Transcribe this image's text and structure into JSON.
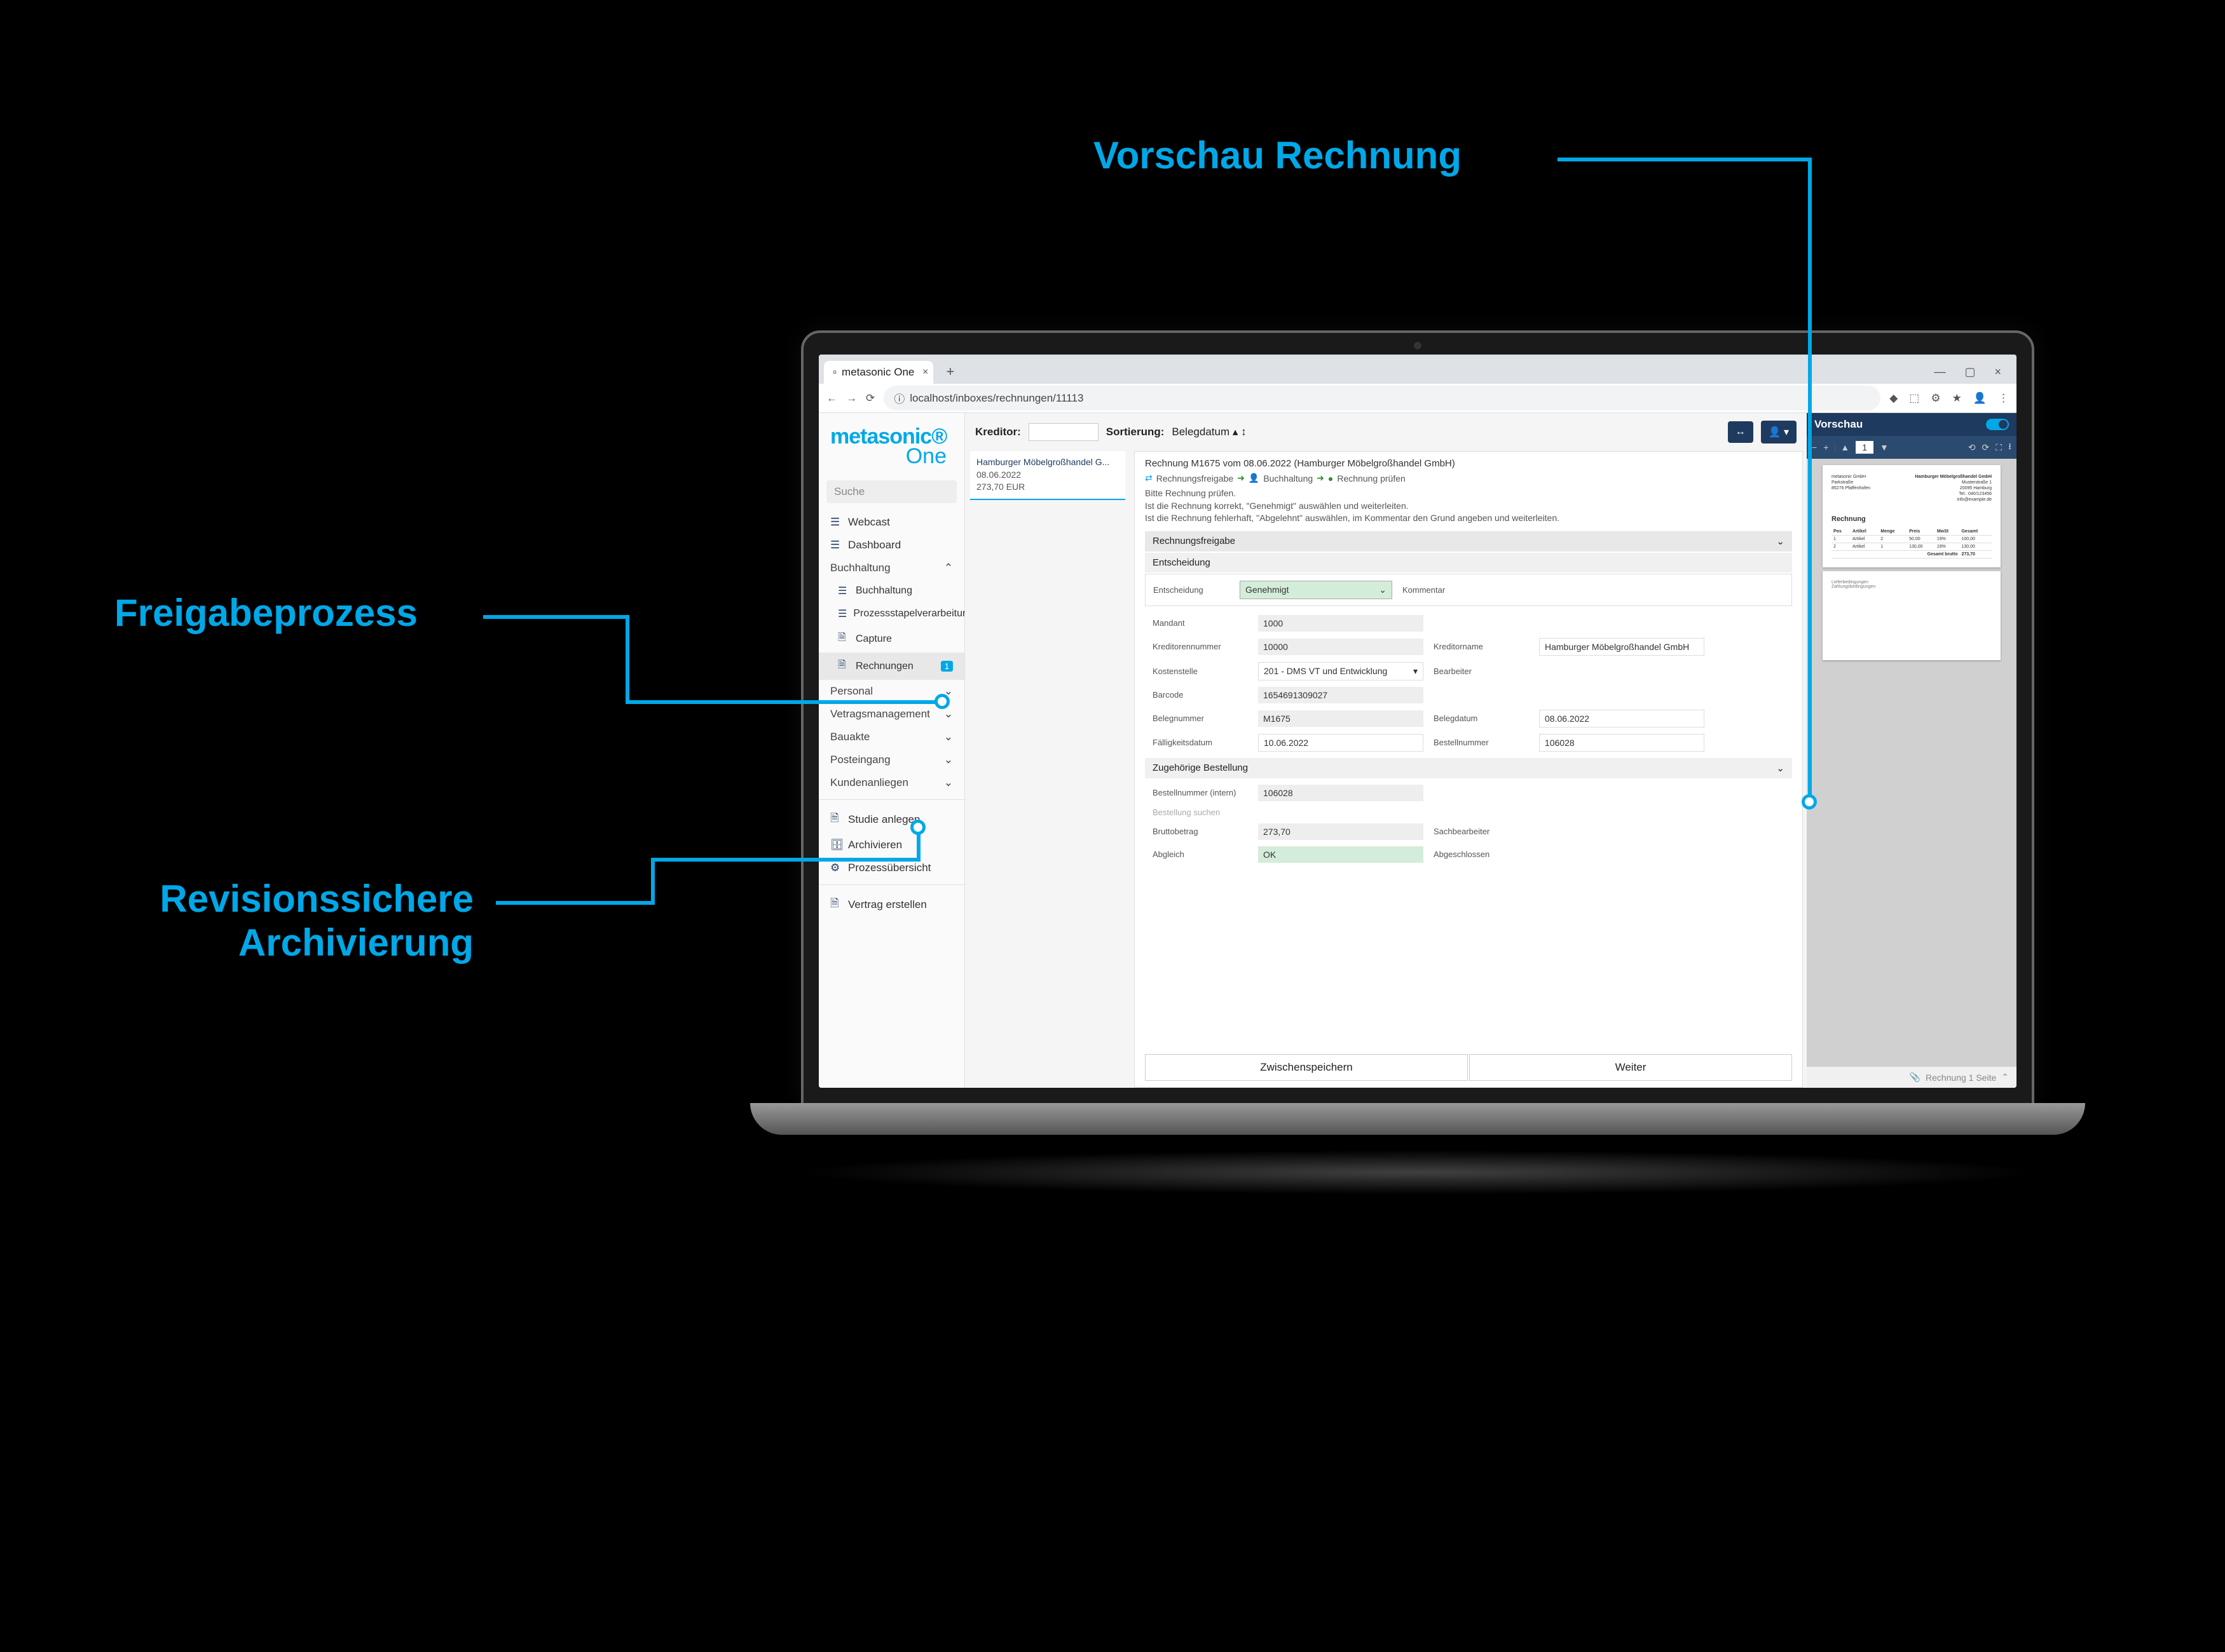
{
  "annotations": {
    "preview": "Vorschau Rechnung",
    "approval": "Freigabeprozess",
    "archive1": "Revisionssichere",
    "archive2": "Archivierung"
  },
  "browser": {
    "tab_title": "metasonic One",
    "url": "localhost/inboxes/rechnungen/11113"
  },
  "logo": {
    "line1": "metasonic",
    "line2": "One"
  },
  "sidebar": {
    "search_placeholder": "Suche",
    "items": {
      "webcast": "Webcast",
      "dashboard": "Dashboard",
      "buchhaltung": "Buchhaltung",
      "buchhaltung2": "Buchhaltung",
      "prozessstapel": "Prozessstapelverarbeitung",
      "capture": "Capture",
      "rechnungen": "Rechnungen",
      "rechnungen_badge": "1",
      "personal": "Personal",
      "vertrag": "Vetragsmanagement",
      "bauakte": "Bauakte",
      "posteingang": "Posteingang",
      "kunden": "Kundenanliegen",
      "studie": "Studie anlegen",
      "archivieren": "Archivieren",
      "prozess_uebersicht": "Prozessübersicht",
      "vertrag_erstellen": "Vertrag erstellen"
    }
  },
  "toolbar": {
    "kreditor_label": "Kreditor:",
    "sortierung_label": "Sortierung:",
    "sortierung_value": "Belegdatum"
  },
  "list": {
    "item1": {
      "title": "Hamburger Möbelgroßhandel G...",
      "date": "08.06.2022",
      "amount": "273,70 EUR"
    }
  },
  "detail": {
    "title": "Rechnung M1675 vom 08.06.2022 (Hamburger Möbelgroßhandel GmbH)",
    "flow_step1": "Rechnungsfreigabe",
    "flow_step2": "Buchhaltung",
    "flow_step3": "Rechnung prüfen",
    "instr_line1": "Bitte Rechnung prüfen.",
    "instr_line2": "Ist die Rechnung korrekt, \"Genehmigt\" auswählen und weiterleiten.",
    "instr_line3": "Ist die Rechnung fehlerhaft, \"Abgelehnt\" auswählen, im Kommentar den Grund angeben und weiterleiten.",
    "section_freigabe": "Rechnungsfreigabe",
    "section_entscheidung": "Entscheidung",
    "entscheidung_label": "Entscheidung",
    "entscheidung_value": "Genehmigt",
    "kommentar_label": "Kommentar",
    "mandant_label": "Mandant",
    "mandant_value": "1000",
    "kreditornummer_label": "Kreditorennummer",
    "kreditornummer_value": "10000",
    "kreditorname_label": "Kreditorname",
    "kreditorname_value": "Hamburger Möbelgroßhandel GmbH",
    "kostenstelle_label": "Kostenstelle",
    "kostenstelle_value": "201 - DMS VT und Entwicklung",
    "bearbeiter_label": "Bearbeiter",
    "barcode_label": "Barcode",
    "barcode_value": "1654691309027",
    "belegnummer_label": "Belegnummer",
    "belegnummer_value": "M1675",
    "belegdatum_label": "Belegdatum",
    "belegdatum_value": "08.06.2022",
    "faelligkeit_label": "Fälligkeitsdatum",
    "faelligkeit_value": "10.06.2022",
    "bestellnummer_label": "Bestellnummer",
    "bestellnummer_value": "106028",
    "section_bestellung": "Zugehörige Bestellung",
    "bestellnr_intern_label": "Bestellnummer (intern)",
    "bestellnr_intern_value": "106028",
    "bestellung_suchen": "Bestellung suchen",
    "bruttobetrag_label": "Bruttobetrag",
    "bruttobetrag_value": "273,70",
    "sachbearbeiter_label": "Sachbearbeiter",
    "abgleich_label": "Abgleich",
    "abgleich_value": "OK",
    "abgeschlossen_label": "Abgeschlossen",
    "btn_save": "Zwischenspeichern",
    "btn_continue": "Weiter"
  },
  "preview": {
    "title": "Vorschau",
    "page_indicator": "1",
    "doc_company": "Hamburger Möbelgroßhandel GmbH",
    "doc_title": "Rechnung",
    "footer": "Rechnung 1 Seite"
  }
}
